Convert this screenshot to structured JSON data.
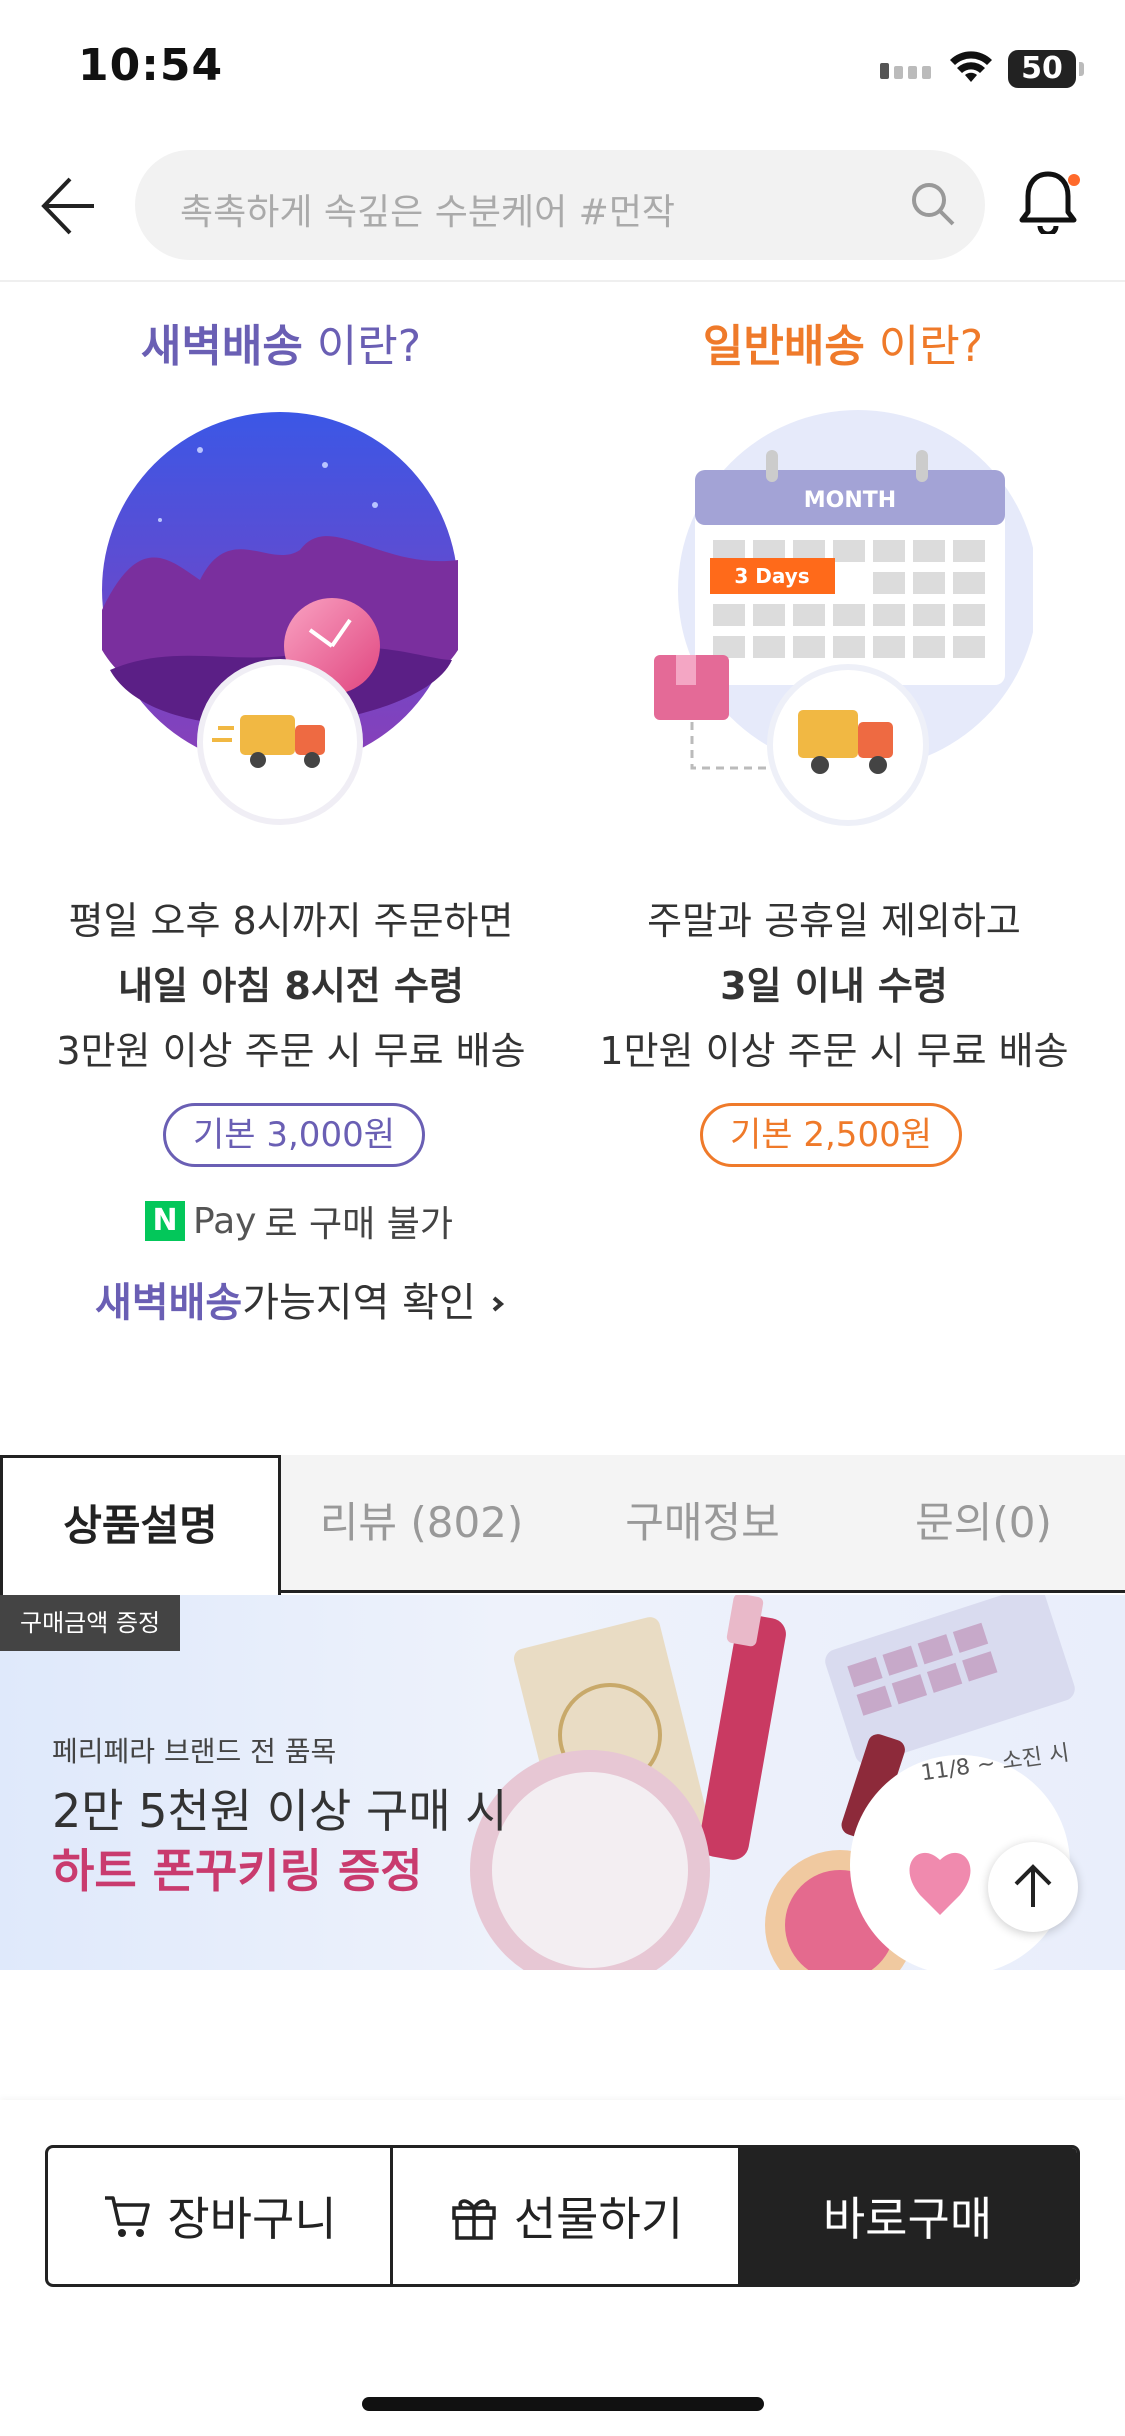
{
  "status_bar": {
    "time": "10:54",
    "battery": "50"
  },
  "header": {
    "search_placeholder": "촉촉하게 속깊은 수분케어 #먼작"
  },
  "dawn_delivery": {
    "title_strong": "새벽배송",
    "title_rest": " 이란?",
    "line1": "평일 오후 8시까지 주문하면",
    "line2": "내일 아침 8시전 수령",
    "line3": "3만원 이상 주문 시 무료 배송",
    "price": "기본 3,000원",
    "npay_word": "Pay",
    "npay_text": "로 구매 불가",
    "area_strong": "새벽배송",
    "area_rest": "가능지역 확인"
  },
  "general_delivery": {
    "title_strong": "일반배송",
    "title_rest": " 이란?",
    "calendar_label": "MONTH",
    "days_label": "3 Days",
    "line1": "주말과 공휴일 제외하고",
    "line2": "3일 이내 수령",
    "line3": "1만원 이상 주문 시 무료 배송",
    "price": "기본 2,500원"
  },
  "tabs": [
    {
      "label": "상품설명",
      "active": true
    },
    {
      "label": "리뷰 (802)",
      "active": false
    },
    {
      "label": "구매정보",
      "active": false
    },
    {
      "label": "문의(0)",
      "active": false
    }
  ],
  "banner": {
    "badge": "구매금액 증정",
    "small": "페리페라 브랜드 전 품목",
    "main": "2만 5천원 이상 구매 시",
    "highlight": "하트 폰꾸키링 증정",
    "date": "11/8 ~ 소진 시"
  },
  "bottom_bar": {
    "cart_label": "장바구니",
    "gift_label": "선물하기",
    "buy_label": "바로구매"
  },
  "colors": {
    "dawn": "#6a5fb4",
    "general": "#ef7a2a",
    "dark": "#222222"
  }
}
